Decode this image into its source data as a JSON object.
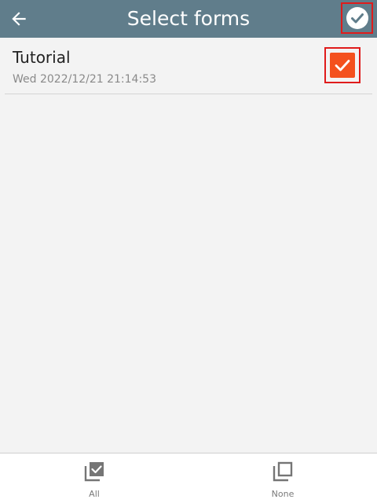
{
  "header": {
    "title": "Select forms",
    "bg_color": "#607d8b",
    "back_icon": "arrow-left-icon",
    "confirm_icon": "check-circle-icon"
  },
  "forms": [
    {
      "name": "Tutorial",
      "date": "Wed 2022/12/21 21:14:53",
      "checked": true,
      "check_color": "#f4511e"
    }
  ],
  "bottom_bar": {
    "all_label": "All",
    "all_icon": "select-all-icon",
    "none_label": "None",
    "none_icon": "select-none-icon"
  },
  "highlight_color": "#e01b1b"
}
